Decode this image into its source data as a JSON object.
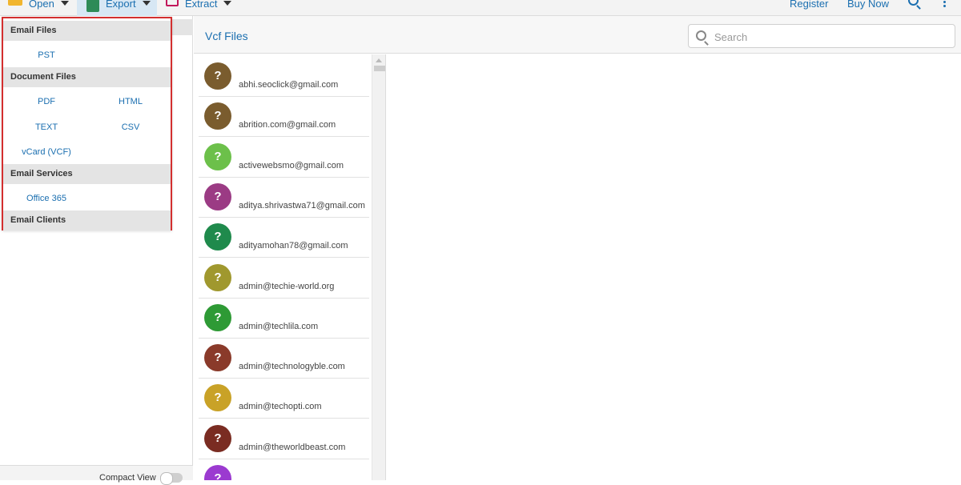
{
  "toolbar": {
    "open": "Open",
    "export": "Export",
    "extract": "Extract",
    "register": "Register",
    "buy_now": "Buy Now"
  },
  "export_menu": {
    "sections": [
      {
        "title": "Email Files",
        "items": [
          "PST"
        ]
      },
      {
        "title": "Document Files",
        "items": [
          "PDF",
          "HTML",
          "TEXT",
          "CSV",
          "vCard (VCF)"
        ]
      },
      {
        "title": "Email Services",
        "items": [
          "Office 365"
        ]
      },
      {
        "title": "Email Clients",
        "items": []
      }
    ]
  },
  "left_footer": {
    "compact_view": "Compact View"
  },
  "list_header": {
    "title": "Vcf Files",
    "search_placeholder": "Search"
  },
  "contacts": [
    {
      "email": "abhi.seoclick@gmail.com",
      "color": "#7a5c2e"
    },
    {
      "email": "abrition.com@gmail.com",
      "color": "#7a5c2e"
    },
    {
      "email": "activewebsmo@gmail.com",
      "color": "#6cc04a"
    },
    {
      "email": "aditya.shrivastwa71@gmail.com",
      "color": "#9b3b84"
    },
    {
      "email": "adityamohan78@gmail.com",
      "color": "#1f8a4c"
    },
    {
      "email": "admin@techie-world.org",
      "color": "#a0982e"
    },
    {
      "email": "admin@techlila.com",
      "color": "#2e9a35"
    },
    {
      "email": "admin@technologyble.com",
      "color": "#8a3a2a"
    },
    {
      "email": "admin@techopti.com",
      "color": "#c9a227"
    },
    {
      "email": "admin@theworldbeast.com",
      "color": "#7a2c22"
    },
    {
      "email": "",
      "color": "#9b3ad0"
    }
  ],
  "avatar_glyph": "?"
}
